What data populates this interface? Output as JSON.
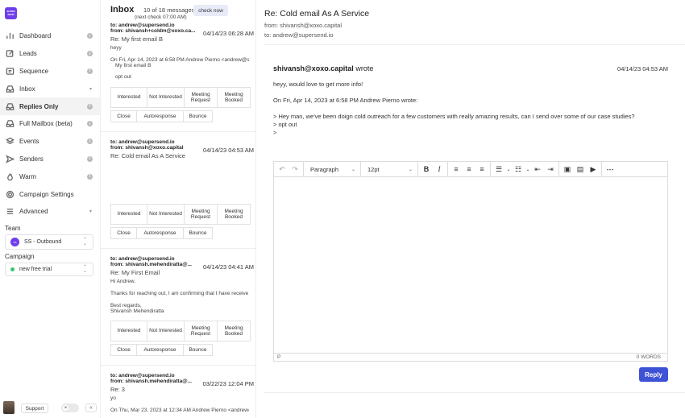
{
  "logo": {
    "text": "SUPER SEND"
  },
  "sidebar": {
    "items": [
      {
        "label": "Dashboard",
        "icon": "bar-chart-icon",
        "info": true
      },
      {
        "label": "Leads",
        "icon": "edit-icon",
        "info": true
      },
      {
        "label": "Sequence",
        "icon": "sequence-icon",
        "info": true
      },
      {
        "label": "Inbox",
        "icon": "inbox-icon",
        "caret": "▾"
      },
      {
        "label": "Replies Only",
        "icon": "replies-icon",
        "info": true,
        "active": true
      },
      {
        "label": "Full Mailbox (beta)",
        "icon": "mailbox-icon",
        "info": true
      },
      {
        "label": "Events",
        "icon": "events-icon",
        "info": true
      },
      {
        "label": "Senders",
        "icon": "send-icon",
        "info": true
      },
      {
        "label": "Warm",
        "icon": "flame-icon",
        "info": true
      },
      {
        "label": "Campaign Settings",
        "icon": "gear-icon"
      },
      {
        "label": "Advanced",
        "icon": "sliders-icon",
        "caret": "▾"
      }
    ],
    "team_label": "Team",
    "team_value": "SS - Outbound",
    "campaign_label": "Campaign",
    "campaign_value": "new free trial",
    "support_label": "Support",
    "toggle_label": "×",
    "collapse_label": "«"
  },
  "inbox": {
    "title": "Inbox",
    "count": "10 of 18 messages",
    "next_check": "(next check 07:00 AM)",
    "check_now": "check now",
    "tags": [
      "Interested",
      "Not Interested",
      "Meeting Request",
      "Meeting Booked"
    ],
    "actions": [
      "Close",
      "Autoresponse",
      "Bounce"
    ],
    "messages": [
      {
        "to": "to: andrew@supersend.io",
        "from": "from: shivansh+coldm@xoxo.ca...",
        "date": "04/14/23 06:28 AM",
        "subject": "Re: My first email B",
        "body": [
          "heyy",
          "",
          "On Fri, Apr 14, 2023 at 6:58 PM Andrew Pierno <andrew@s",
          "My first email B",
          "",
          "opt out"
        ]
      },
      {
        "to": "to: andrew@supersend.io",
        "from": "from: shivansh@xoxo.capital",
        "date": "04/14/23 04:53 AM",
        "subject": "Re: Cold email As A Service",
        "body": []
      },
      {
        "to": "to: andrew@supersend.io",
        "from": "from: shivansh.mehendiratta@...",
        "date": "04/14/23 04:41 AM",
        "subject": "Re: My First Email",
        "body": [
          "Hi Andrew,",
          "",
          "Thanks for reaching out, I am confirming that I have receive",
          "",
          "Best regards,",
          "Shivansh Mehendiratta"
        ]
      },
      {
        "to": "to: andrew@supersend.io",
        "from": "from: shivansh.mehendiratta@...",
        "date": "03/22/23 12:04 PM",
        "subject": "Re: 3",
        "body": [
          "yo",
          "",
          "On Thu, Mar 23, 2023 at 12:34 AM Andrew Pierno <andrew@s"
        ]
      }
    ]
  },
  "pane": {
    "subject": "Re: Cold email As A Service",
    "from": "from: shivansh@xoxo.capital",
    "to": "to: andrew@supersend.io",
    "sender": "shivansh@xoxo.capital",
    "wrote": "wrote",
    "date": "04/14/23 04:53 AM",
    "lines": [
      "heyy, would love to get more info!",
      "On Fri, Apr 14, 2023 at 6:58 PM Andrew Pierno  wrote:",
      "> Hey man, we've been doign cold outreach for a few customers with really amazing results, can I send over some of our case studies?",
      "> opt out",
      ">"
    ]
  },
  "editor": {
    "format": "Paragraph",
    "size": "12pt",
    "status_path": "P",
    "word_count": "0 WORDS",
    "reply_label": "Reply"
  }
}
